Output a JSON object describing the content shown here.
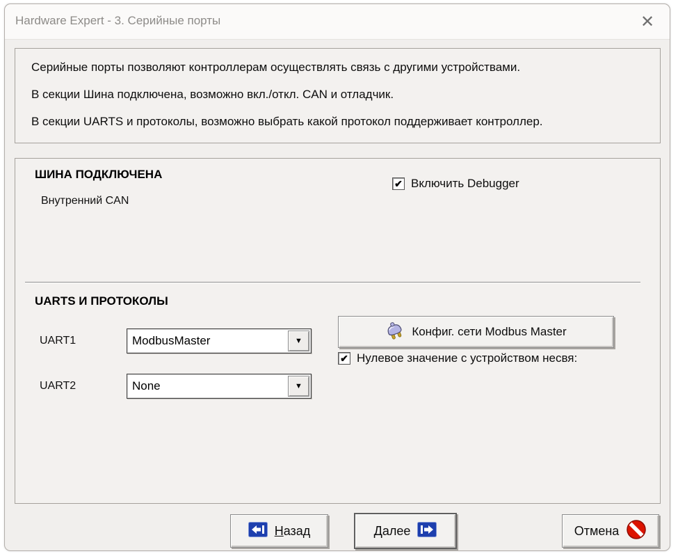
{
  "window": {
    "title": "Hardware Expert - 3. Серийные порты"
  },
  "icons": {
    "close": "✕",
    "check": "✔",
    "dropdown_arrow": "▼",
    "config_button_icon": "plug-icon",
    "back_icon": "arrow-left-to-bar",
    "next_icon": "arrow-right-from-bar",
    "cancel_icon": "no-entry-sign"
  },
  "intro": {
    "lines": [
      "Серийные порты позволяют контроллерам осуществлять связь с другими устройствами.",
      "В секции Шина подключена, возможно вкл./откл. CAN и отладчик.",
      "В секции UARTS и протоколы, возможно выбрать какой протокол поддерживает контроллер."
    ]
  },
  "bus_section": {
    "heading": "ШИНА ПОДКЛЮЧЕНА",
    "bus_name": "Внутренний CAN",
    "debugger_checkbox": {
      "label": "Включить Debugger",
      "checked": true
    }
  },
  "uart_section": {
    "heading": "UARTS И ПРОТОКОЛЫ",
    "uart1": {
      "label": "UART1",
      "value": "ModbusMaster"
    },
    "uart2": {
      "label": "UART2",
      "value": "None"
    },
    "config_button_label": "Конфиг. сети Modbus Master",
    "null_value_checkbox": {
      "label": "Нулевое значение с устройством несвя:",
      "checked": true
    }
  },
  "footer": {
    "back": {
      "mnemonic": "Н",
      "rest": "азад"
    },
    "next": {
      "mnemonic": "Д",
      "rest": "алее"
    },
    "cancel": {
      "label": "Отмена"
    }
  },
  "colors": {
    "accent_blue": "#1d3fae",
    "cancel_red": "#dc1400",
    "plug_lavender": "#b4b4e4",
    "prong_gold": "#c8a22a"
  }
}
